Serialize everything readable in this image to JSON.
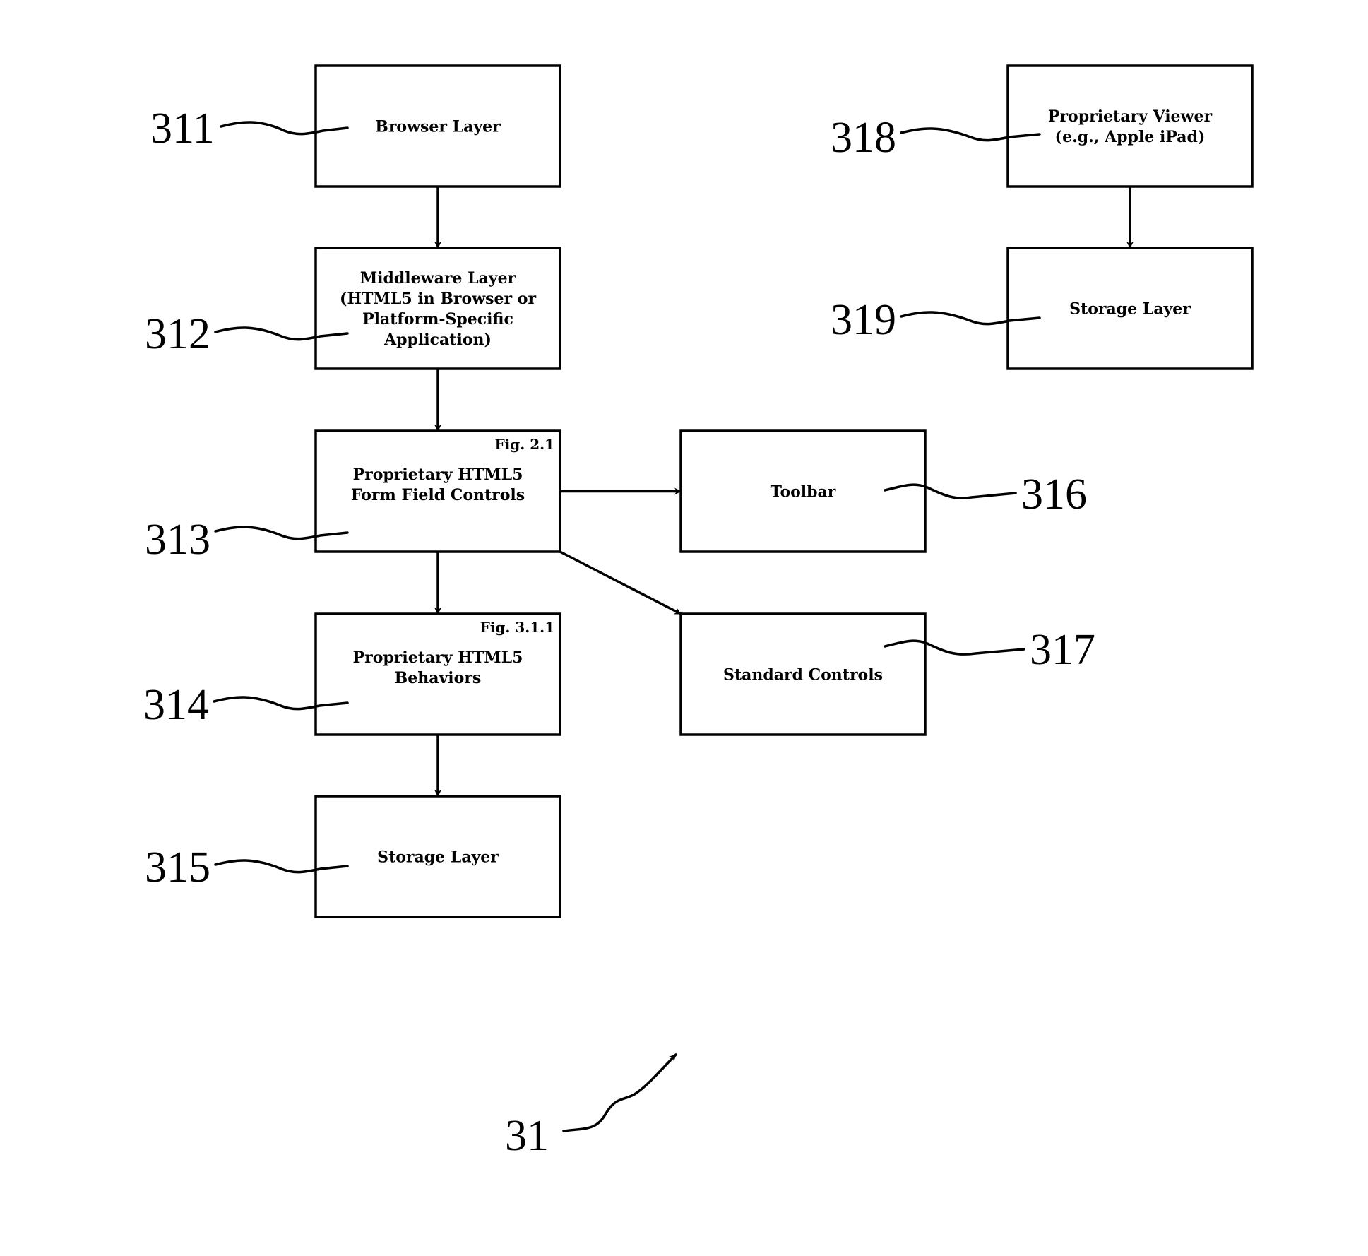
{
  "diagram": {
    "figure_ref": "31",
    "boxes": [
      {
        "id": "311",
        "ref": "311",
        "lines": [
          "Browser Layer"
        ],
        "tag": ""
      },
      {
        "id": "312",
        "ref": "312",
        "lines": [
          "Middleware Layer",
          "(HTML5 in Browser or",
          "Platform-Specific",
          "Application)"
        ],
        "tag": ""
      },
      {
        "id": "313",
        "ref": "313",
        "lines": [
          "Proprietary HTML5",
          "Form Field Controls"
        ],
        "tag": "Fig. 2.1"
      },
      {
        "id": "314",
        "ref": "314",
        "lines": [
          "Proprietary HTML5",
          "Behaviors"
        ],
        "tag": "Fig. 3.1.1"
      },
      {
        "id": "315",
        "ref": "315",
        "lines": [
          "Storage Layer"
        ],
        "tag": ""
      },
      {
        "id": "316",
        "ref": "316",
        "lines": [
          "Toolbar"
        ],
        "tag": ""
      },
      {
        "id": "317",
        "ref": "317",
        "lines": [
          "Standard Controls"
        ],
        "tag": ""
      },
      {
        "id": "318",
        "ref": "318",
        "lines": [
          "Proprietary Viewer",
          "(e.g., Apple iPad)"
        ],
        "tag": ""
      },
      {
        "id": "319",
        "ref": "319",
        "lines": [
          "Storage Layer"
        ],
        "tag": ""
      }
    ],
    "edges": [
      {
        "from": "311",
        "to": "312"
      },
      {
        "from": "312",
        "to": "313"
      },
      {
        "from": "313",
        "to": "314"
      },
      {
        "from": "314",
        "to": "315"
      },
      {
        "from": "313",
        "to": "316"
      },
      {
        "from": "313",
        "to": "317"
      },
      {
        "from": "318",
        "to": "319"
      }
    ]
  }
}
